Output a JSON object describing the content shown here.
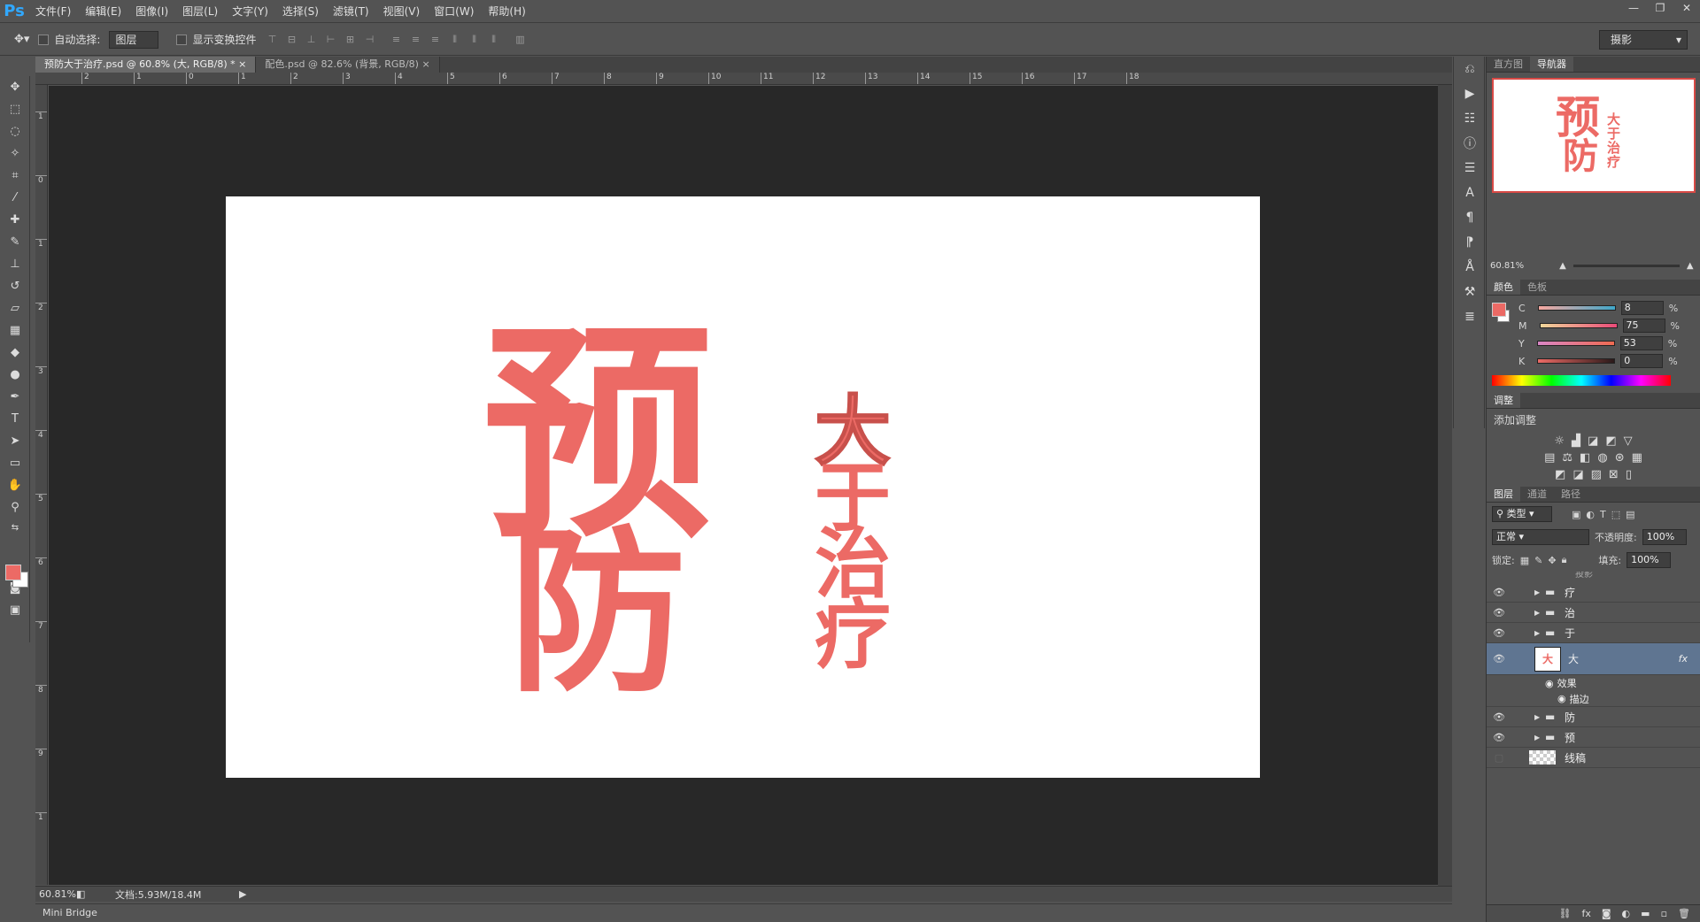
{
  "app": {
    "logo": "Ps"
  },
  "menu": [
    "文件(F)",
    "编辑(E)",
    "图像(I)",
    "图层(L)",
    "文字(Y)",
    "选择(S)",
    "滤镜(T)",
    "视图(V)",
    "窗口(W)",
    "帮助(H)"
  ],
  "window_controls": {
    "minimize": "—",
    "restore": "❐",
    "close": "✕"
  },
  "options": {
    "auto_select_label": "自动选择:",
    "auto_select_value": "图层",
    "show_transform_label": "显示变换控件",
    "workspace": "摄影"
  },
  "tabs": [
    {
      "label": "预防大于治疗.psd @ 60.8% (大, RGB/8) *",
      "close": "×"
    },
    {
      "label": "配色.psd @ 82.6% (背景, RGB/8)",
      "close": "×"
    }
  ],
  "ruler_h": [
    "2",
    "1",
    "0",
    "1",
    "2",
    "3",
    "4",
    "5",
    "6",
    "7",
    "8",
    "9",
    "10",
    "11",
    "12",
    "13",
    "14",
    "15",
    "16",
    "17",
    "18"
  ],
  "ruler_v": [
    "1",
    "0",
    "1",
    "2",
    "3",
    "4",
    "5",
    "6",
    "7",
    "8",
    "9",
    "1"
  ],
  "canvas": {
    "big_text": [
      "预",
      "防"
    ],
    "small_text": [
      "大",
      "于",
      "治",
      "疗"
    ],
    "color": "#ec6a65"
  },
  "status": {
    "zoom": "60.81%",
    "doc": "文档:5.93M/18.4M"
  },
  "minibridge": "Mini Bridge",
  "nav": {
    "tabs": [
      "直方图",
      "导航器"
    ],
    "zoom": "60.81%"
  },
  "color_panel": {
    "tabs": [
      "颜色",
      "色板"
    ],
    "channels": [
      {
        "name": "C",
        "value": "8",
        "unit": "%",
        "grad": "linear-gradient(90deg,#f7a8a0,#3fa7c9)"
      },
      {
        "name": "M",
        "value": "75",
        "unit": "%",
        "grad": "linear-gradient(90deg,#f0d79a,#e94a78)"
      },
      {
        "name": "Y",
        "value": "53",
        "unit": "%",
        "grad": "linear-gradient(90deg,#d986c6,#ef6a50)"
      },
      {
        "name": "K",
        "value": "0",
        "unit": "%",
        "grad": "linear-gradient(90deg,#ec6a65,#2a1a1a)"
      }
    ]
  },
  "adjust_panel": {
    "tab": "调整",
    "title": "添加调整"
  },
  "layers_panel": {
    "tabs": [
      "图层",
      "通道",
      "路径"
    ],
    "kind": "类型",
    "blend": "正常",
    "opacity_label": "不透明度:",
    "opacity": "100%",
    "lock_label": "锁定:",
    "fill_label": "填充:",
    "fill": "100%",
    "top_partial": "投影",
    "layers": [
      {
        "name": "疗",
        "type": "group"
      },
      {
        "name": "治",
        "type": "group"
      },
      {
        "name": "于",
        "type": "group"
      },
      {
        "name": "大",
        "type": "layer",
        "fx": "fx"
      },
      {
        "name": "效果",
        "type": "effect"
      },
      {
        "name": "描边",
        "type": "effect-sub"
      },
      {
        "name": "防",
        "type": "group"
      },
      {
        "name": "预",
        "type": "group"
      },
      {
        "name": "线稿",
        "type": "raster"
      }
    ]
  }
}
